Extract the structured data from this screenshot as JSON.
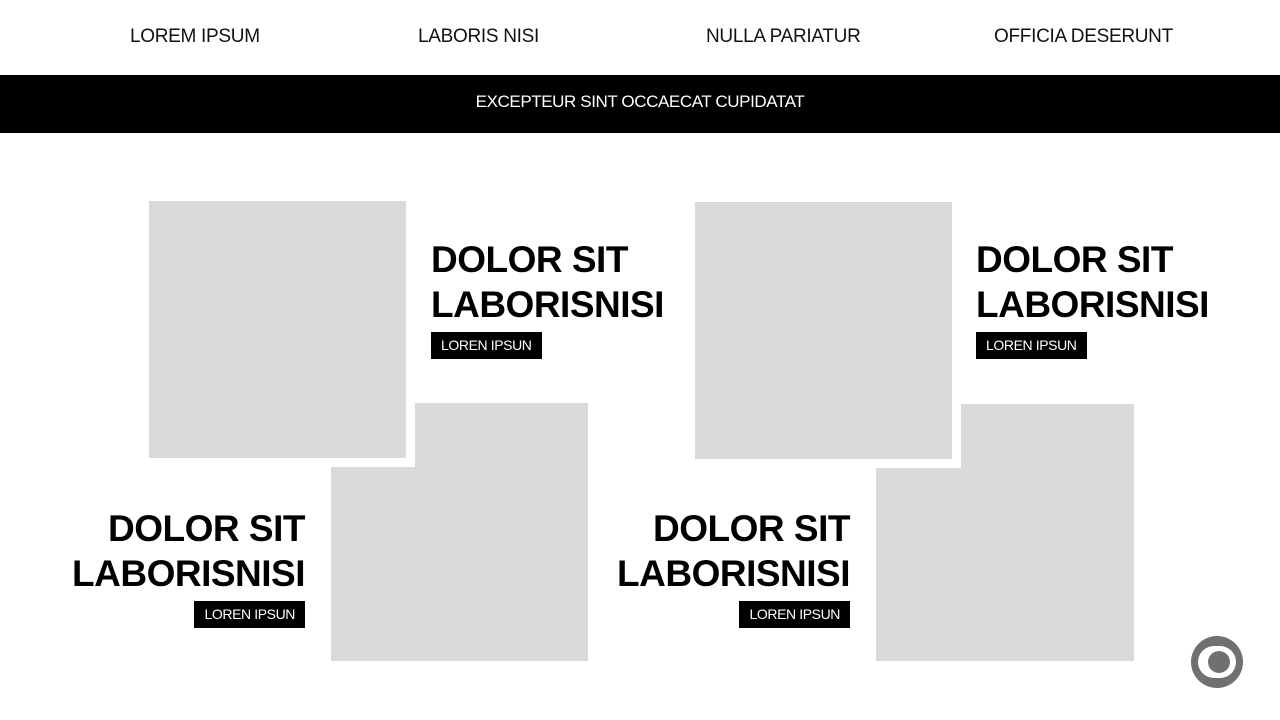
{
  "nav": {
    "items": [
      {
        "label": "LOREM IPSUM"
      },
      {
        "label": "LABORIS NISI"
      },
      {
        "label": "NULLA PARIATUR"
      },
      {
        "label": "OFFICIA DESERUNT"
      }
    ]
  },
  "banner": {
    "text": "EXCEPTEUR SINT OCCAECAT CUPIDATAT"
  },
  "cards": [
    {
      "line1": "DOLOR SIT",
      "line2": "LABORISNISI",
      "tag": "LOREN IPSUN"
    },
    {
      "line1": "DOLOR SIT",
      "line2": "LABORISNISI",
      "tag": "LOREN IPSUN"
    },
    {
      "line1": "DOLOR SIT",
      "line2": "LABORISNISI",
      "tag": "LOREN IPSUN"
    },
    {
      "line1": "DOLOR SIT",
      "line2": "LABORISNISI",
      "tag": "LOREN IPSUN"
    }
  ],
  "floating_button": {
    "icon": "tv-logo-icon",
    "color": "#707070"
  }
}
